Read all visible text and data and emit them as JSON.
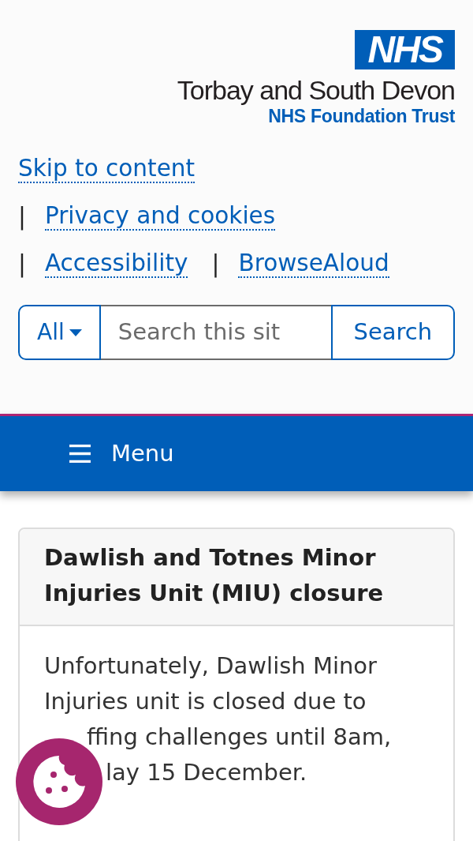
{
  "logo": {
    "badge": "NHS",
    "name": "Torbay and South Devon",
    "subtitle": "NHS Foundation Trust"
  },
  "links": [
    {
      "label": "Skip to content"
    },
    {
      "label": "Privacy and cookies",
      "separator": "|"
    },
    {
      "label": "Accessibility",
      "separator": "|"
    },
    {
      "label": "BrowseAloud",
      "separator": "|"
    }
  ],
  "search": {
    "scope": "All",
    "placeholder": "Search this sit",
    "button": "Search"
  },
  "nav": {
    "menu": "Menu"
  },
  "alert": {
    "title": "Dawlish and Totnes Minor Injuries Unit (MIU) closure",
    "lines": [
      "Unfortunately, Dawlish Minor",
      "Injuries unit is closed due to",
      "ffing challenges until 8am,",
      "lay 15 December."
    ]
  }
}
